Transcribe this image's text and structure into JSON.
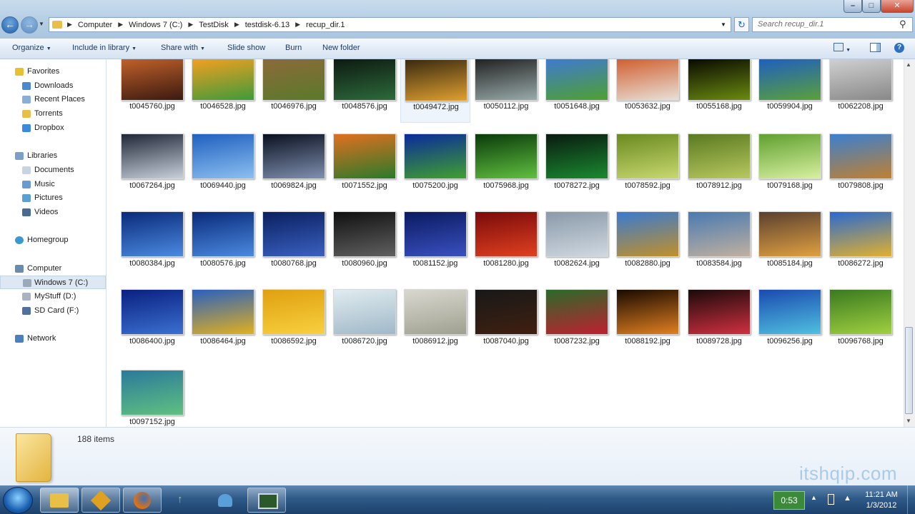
{
  "address": {
    "crumbs": [
      "Computer",
      "Windows 7 (C:)",
      "TestDisk",
      "testdisk-6.13",
      "recup_dir.1"
    ]
  },
  "search": {
    "placeholder": "Search recup_dir.1"
  },
  "toolbar": {
    "organize": "Organize",
    "include": "Include in library",
    "share": "Share with",
    "slideshow": "Slide show",
    "burn": "Burn",
    "newfolder": "New folder"
  },
  "sidebar": {
    "favorites": "Favorites",
    "downloads": "Downloads",
    "recent": "Recent Places",
    "torrents": "Torrents",
    "dropbox": "Dropbox",
    "libraries": "Libraries",
    "documents": "Documents",
    "music": "Music",
    "pictures": "Pictures",
    "videos": "Videos",
    "homegroup": "Homegroup",
    "computer": "Computer",
    "windows7": "Windows 7 (C:)",
    "mystuff": "MyStuff (D:)",
    "sdcard": "SD Card (F:)",
    "network": "Network"
  },
  "files": [
    "t0045760.jpg",
    "t0046528.jpg",
    "t0046976.jpg",
    "t0048576.jpg",
    "t0049472.jpg",
    "t0050112.jpg",
    "t0051648.jpg",
    "t0053632.jpg",
    "t0055168.jpg",
    "t0059904.jpg",
    "t0062208.jpg",
    "t0067264.jpg",
    "t0069440.jpg",
    "t0069824.jpg",
    "t0071552.jpg",
    "t0075200.jpg",
    "t0075968.jpg",
    "t0078272.jpg",
    "t0078592.jpg",
    "t0078912.jpg",
    "t0079168.jpg",
    "t0079808.jpg",
    "t0080384.jpg",
    "t0080576.jpg",
    "t0080768.jpg",
    "t0080960.jpg",
    "t0081152.jpg",
    "t0081280.jpg",
    "t0082624.jpg",
    "t0082880.jpg",
    "t0083584.jpg",
    "t0085184.jpg",
    "t0086272.jpg",
    "t0086400.jpg",
    "t0086464.jpg",
    "t0086592.jpg",
    "t0086720.jpg",
    "t0086912.jpg",
    "t0087040.jpg",
    "t0087232.jpg",
    "t0088192.jpg",
    "t0089728.jpg",
    "t0096256.jpg",
    "t0096768.jpg",
    "t0097152.jpg"
  ],
  "thumb_colors": [
    [
      "#c0602a",
      "#3a1a10"
    ],
    [
      "#f2a020",
      "#3f9a3a"
    ],
    [
      "#8b6a3a",
      "#5a7a2a"
    ],
    [
      "#0d1a12",
      "#2d6a3a"
    ],
    [
      "#3a2a10",
      "#e0a030"
    ],
    [
      "#222",
      "#9aa"
    ],
    [
      "#3f7ad0",
      "#4fa030"
    ],
    [
      "#d06030",
      "#e8e0d8"
    ],
    [
      "#0a0a00",
      "#6a8a10"
    ],
    [
      "#1f5fbf",
      "#5aa03a"
    ],
    [
      "#d0d0d0",
      "#888"
    ],
    [
      "#202838",
      "#c8d0dc"
    ],
    [
      "#2060c0",
      "#8cc0f0"
    ],
    [
      "#0a1020",
      "#8090b0"
    ],
    [
      "#e07020",
      "#2a7a2a"
    ],
    [
      "#0a2a9a",
      "#40a030"
    ],
    [
      "#0a3a0a",
      "#60c040"
    ],
    [
      "#0a1a10",
      "#1a8a30"
    ],
    [
      "#6a8a20",
      "#c8d870"
    ],
    [
      "#5a7a20",
      "#b8c860"
    ],
    [
      "#60a030",
      "#d8f0a0"
    ],
    [
      "#3a80d0",
      "#c08030"
    ],
    [
      "#0a2a7a",
      "#4a8ae0"
    ],
    [
      "#0a2a7a",
      "#4a8ae0"
    ],
    [
      "#0a2060",
      "#3a60c0"
    ],
    [
      "#101010",
      "#606060"
    ],
    [
      "#0a1a60",
      "#3a50c0"
    ],
    [
      "#7a0a0a",
      "#e04020"
    ],
    [
      "#8a9aaa",
      "#d0d8e0"
    ],
    [
      "#3a7ad0",
      "#c0902a"
    ],
    [
      "#4a7ab0",
      "#c0b0a0"
    ],
    [
      "#5a4030",
      "#e0a040"
    ],
    [
      "#2a6ad0",
      "#e0b030"
    ],
    [
      "#0a2080",
      "#3a70d0"
    ],
    [
      "#2a60c0",
      "#e0b020"
    ],
    [
      "#e0a010",
      "#f8d040"
    ],
    [
      "#e0ecf0",
      "#a0b8c8"
    ],
    [
      "#d8d8d0",
      "#a0a090"
    ],
    [
      "#181818",
      "#402010"
    ],
    [
      "#2a6a2a",
      "#c02030"
    ],
    [
      "#1a0a00",
      "#e08020"
    ],
    [
      "#1a0a0a",
      "#d03040"
    ],
    [
      "#1a4ab0",
      "#50c0e0"
    ],
    [
      "#3a7a20",
      "#a0d040"
    ],
    [
      "#2a7a9a",
      "#60c080"
    ]
  ],
  "details": {
    "count": "188 items"
  },
  "taskbar": {
    "badge": "0:53",
    "time": "11:21 AM",
    "date": "1/3/2012"
  },
  "watermark": "itshqip.com"
}
